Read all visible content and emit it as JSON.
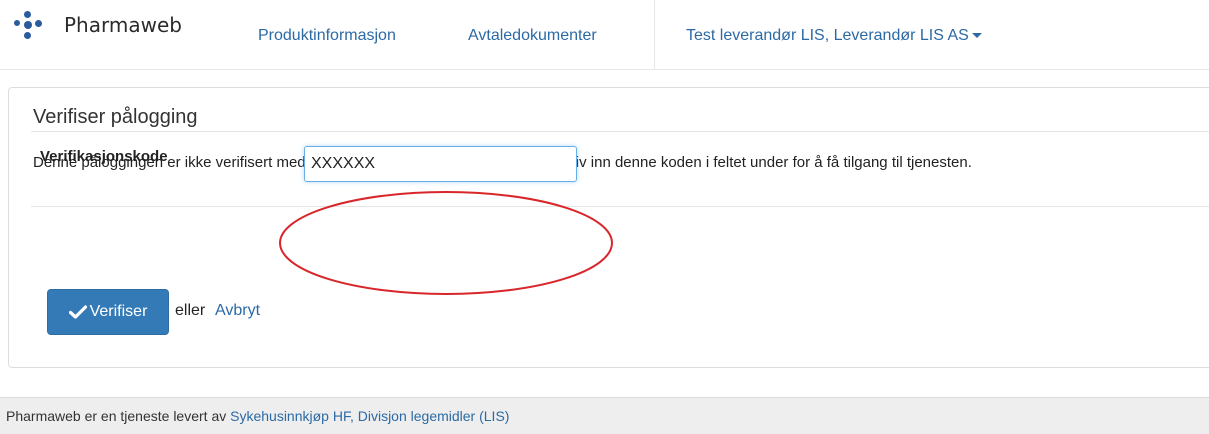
{
  "header": {
    "brand": "Pharmaweb",
    "nav": {
      "produkt": "Produktinformasjon",
      "avtale": "Avtaledokumenter",
      "user": "Test leverandør LIS, Leverandør LIS AS"
    }
  },
  "panel": {
    "title": "Verifiser pålogging",
    "description": "Denne påloggingen er ikke verifisert med kode. Du vil motta en kode pr. SMS. Skriv inn denne koden i feltet under for å få tilgang til tjenesten.",
    "code_label": "Verifikasjonskode",
    "code_value": "XXXXXX",
    "verify_label": "Verifiser",
    "or_text": "eller",
    "cancel_label": "Avbryt"
  },
  "footer": {
    "text": "Pharmaweb er en tjeneste levert av ",
    "link": "Sykehusinnkjøp HF, Divisjon legemidler (LIS)"
  },
  "colors": {
    "link": "#2c6aa5",
    "primary_button": "#337ab7",
    "highlight_ellipse": "#d9262b",
    "logo": "#2a5b9c"
  },
  "icons": [
    "logo-dots-icon",
    "caret-down-icon",
    "checkmark-icon"
  ]
}
